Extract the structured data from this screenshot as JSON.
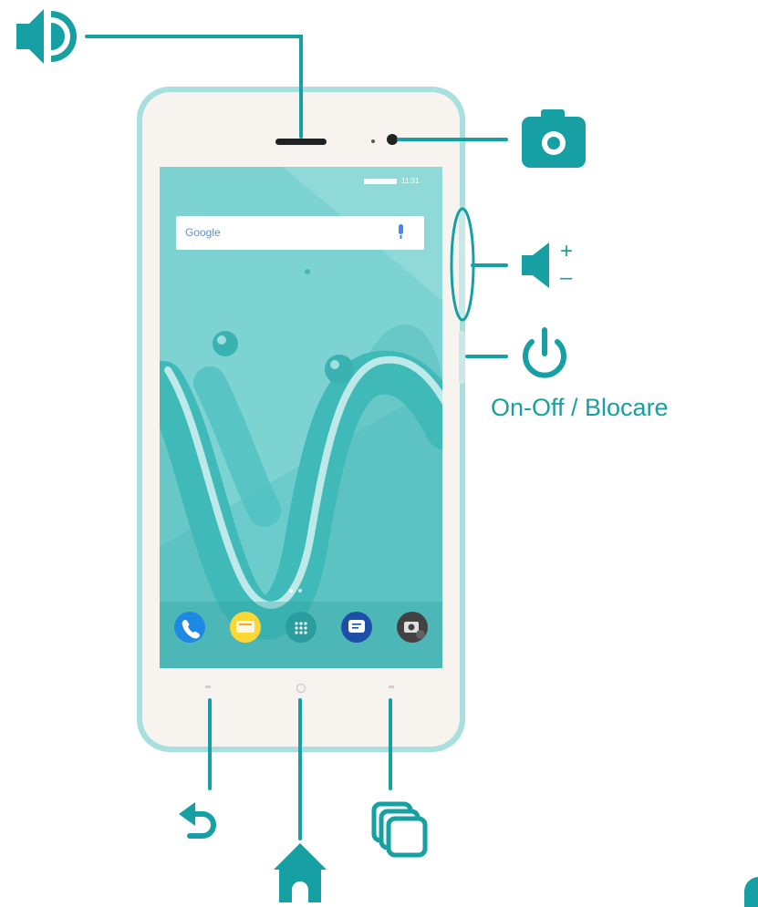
{
  "brand": {
    "accent": "#16a0a3",
    "phone_body": "#f6f2ec",
    "phone_rim": "#9fdcdc",
    "wallpaper": "#63c9ca"
  },
  "labels": {
    "power": "On-Off / Blocare",
    "volume_plus": "+",
    "volume_minus": "–"
  },
  "screen": {
    "status_time": "11:31",
    "search_placeholder": "Google",
    "dock_apps": [
      "phone",
      "messages-yellow",
      "app-drawer",
      "messages-blue",
      "camera"
    ]
  },
  "callouts": [
    {
      "name": "speaker-icon",
      "target": "earpiece"
    },
    {
      "name": "camera-icon",
      "target": "front-camera"
    },
    {
      "name": "volume-icon",
      "target": "volume-buttons"
    },
    {
      "name": "power-icon",
      "target": "power-button"
    },
    {
      "name": "back-icon",
      "target": "back-key"
    },
    {
      "name": "home-icon",
      "target": "home-key"
    },
    {
      "name": "recents-icon",
      "target": "recents-key"
    }
  ]
}
